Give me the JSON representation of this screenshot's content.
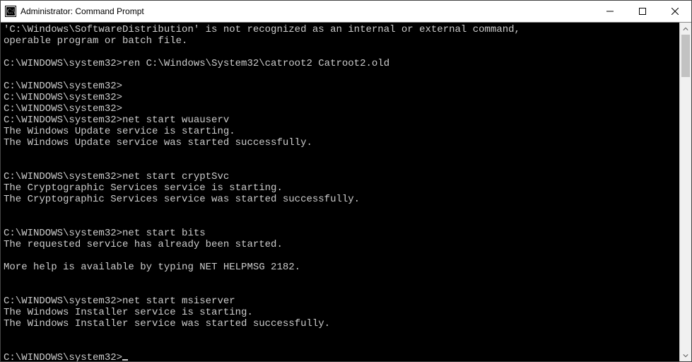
{
  "window": {
    "title": "Administrator: Command Prompt"
  },
  "prompt": "C:\\WINDOWS\\system32>",
  "lines": [
    "'C:\\Windows\\SoftwareDistribution' is not recognized as an internal or external command,",
    "operable program or batch file.",
    "",
    "C:\\WINDOWS\\system32>ren C:\\Windows\\System32\\catroot2 Catroot2.old",
    "",
    "C:\\WINDOWS\\system32>",
    "C:\\WINDOWS\\system32>",
    "C:\\WINDOWS\\system32>",
    "C:\\WINDOWS\\system32>net start wuauserv",
    "The Windows Update service is starting.",
    "The Windows Update service was started successfully.",
    "",
    "",
    "C:\\WINDOWS\\system32>net start cryptSvc",
    "The Cryptographic Services service is starting.",
    "The Cryptographic Services service was started successfully.",
    "",
    "",
    "C:\\WINDOWS\\system32>net start bits",
    "The requested service has already been started.",
    "",
    "More help is available by typing NET HELPMSG 2182.",
    "",
    "",
    "C:\\WINDOWS\\system32>net start msiserver",
    "The Windows Installer service is starting.",
    "The Windows Installer service was started successfully.",
    "",
    "",
    "C:\\WINDOWS\\system32>"
  ]
}
